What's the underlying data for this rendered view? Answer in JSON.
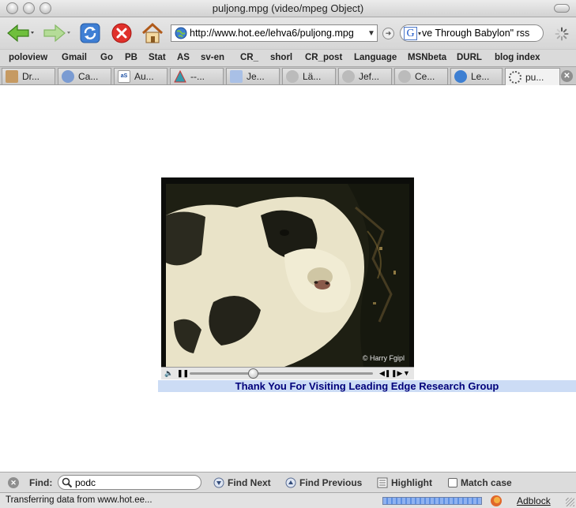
{
  "window": {
    "title": "puljong.mpg (video/mpeg Object)"
  },
  "toolbar": {
    "url": "http://www.hot.ee/lehva6/puljong.mpg",
    "search_text": "ve Through Babylon\" rss",
    "search_engine_glyph": "G",
    "icons": [
      "back-arrow-icon",
      "forward-arrow-icon",
      "reload-icon",
      "stop-icon",
      "home-icon",
      "globe-icon",
      "go-icon",
      "throbber-icon"
    ]
  },
  "bookmarks": [
    "poloview",
    "Gmail",
    "Go",
    "PB",
    "Stat",
    "AS",
    "sv-en",
    "CR_",
    "shorl",
    "CR_post",
    "Language",
    "MSNbeta",
    "DURL",
    "blog index"
  ],
  "tabs": [
    {
      "label": "Dr..."
    },
    {
      "label": "Ca..."
    },
    {
      "label": "Au..."
    },
    {
      "label": "--..."
    },
    {
      "label": "Je..."
    },
    {
      "label": "Lä..."
    },
    {
      "label": "Jef..."
    },
    {
      "label": "Ce..."
    },
    {
      "label": "Le..."
    },
    {
      "label": "pu...",
      "active": true
    }
  ],
  "player": {
    "watermark": "© Harry Fgipl",
    "playback_position": 0.34,
    "banner_text": "Thank You For Visiting Leading Edge Research Group"
  },
  "findbar": {
    "label": "Find:",
    "query": "podc",
    "find_next": "Find Next",
    "find_previous": "Find Previous",
    "highlight": "Highlight",
    "match_case": "Match case"
  },
  "status": {
    "text": "Transferring data from www.hot.ee...",
    "addon_label": "Adblock"
  },
  "colors": {
    "banner_bg": "#ccdcf5",
    "banner_text": "#00007a",
    "progress": "#5d8fe2"
  }
}
